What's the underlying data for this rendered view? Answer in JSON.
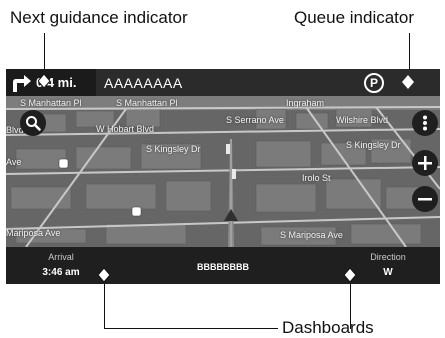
{
  "callouts": {
    "next_guidance": "Next guidance indicator",
    "queue": "Queue indicator",
    "dashboards": "Dashboards"
  },
  "topbar": {
    "distance": "0.4 mi.",
    "street": "AAAAAAAA",
    "parking_badge": "P",
    "icon_turn": "turn-right-arrow-icon",
    "icon_queue": "queue-indicator-icon"
  },
  "map": {
    "roads": [
      "S Manhattan Pl",
      "S Manhattan Pl",
      "Ingraham",
      "W Hobart Blvd",
      "S Serrano Ave",
      "Wilshire Blvd",
      "S Kingsley Dr",
      "S Kingsley Dr",
      "Irolo St",
      "S Mariposa Ave",
      "Mariposa Ave",
      "Blvd",
      "Ave"
    ]
  },
  "dashboard": {
    "arrival_label": "Arrival",
    "arrival_value": "3:46 am",
    "center_text": "BBBBBBBB",
    "direction_label": "Direction",
    "direction_value": "W"
  },
  "colors": {
    "screen_bg": "#5a5a5a",
    "bar_bg": "#2b2b2b",
    "route": "#8a8a8a"
  }
}
